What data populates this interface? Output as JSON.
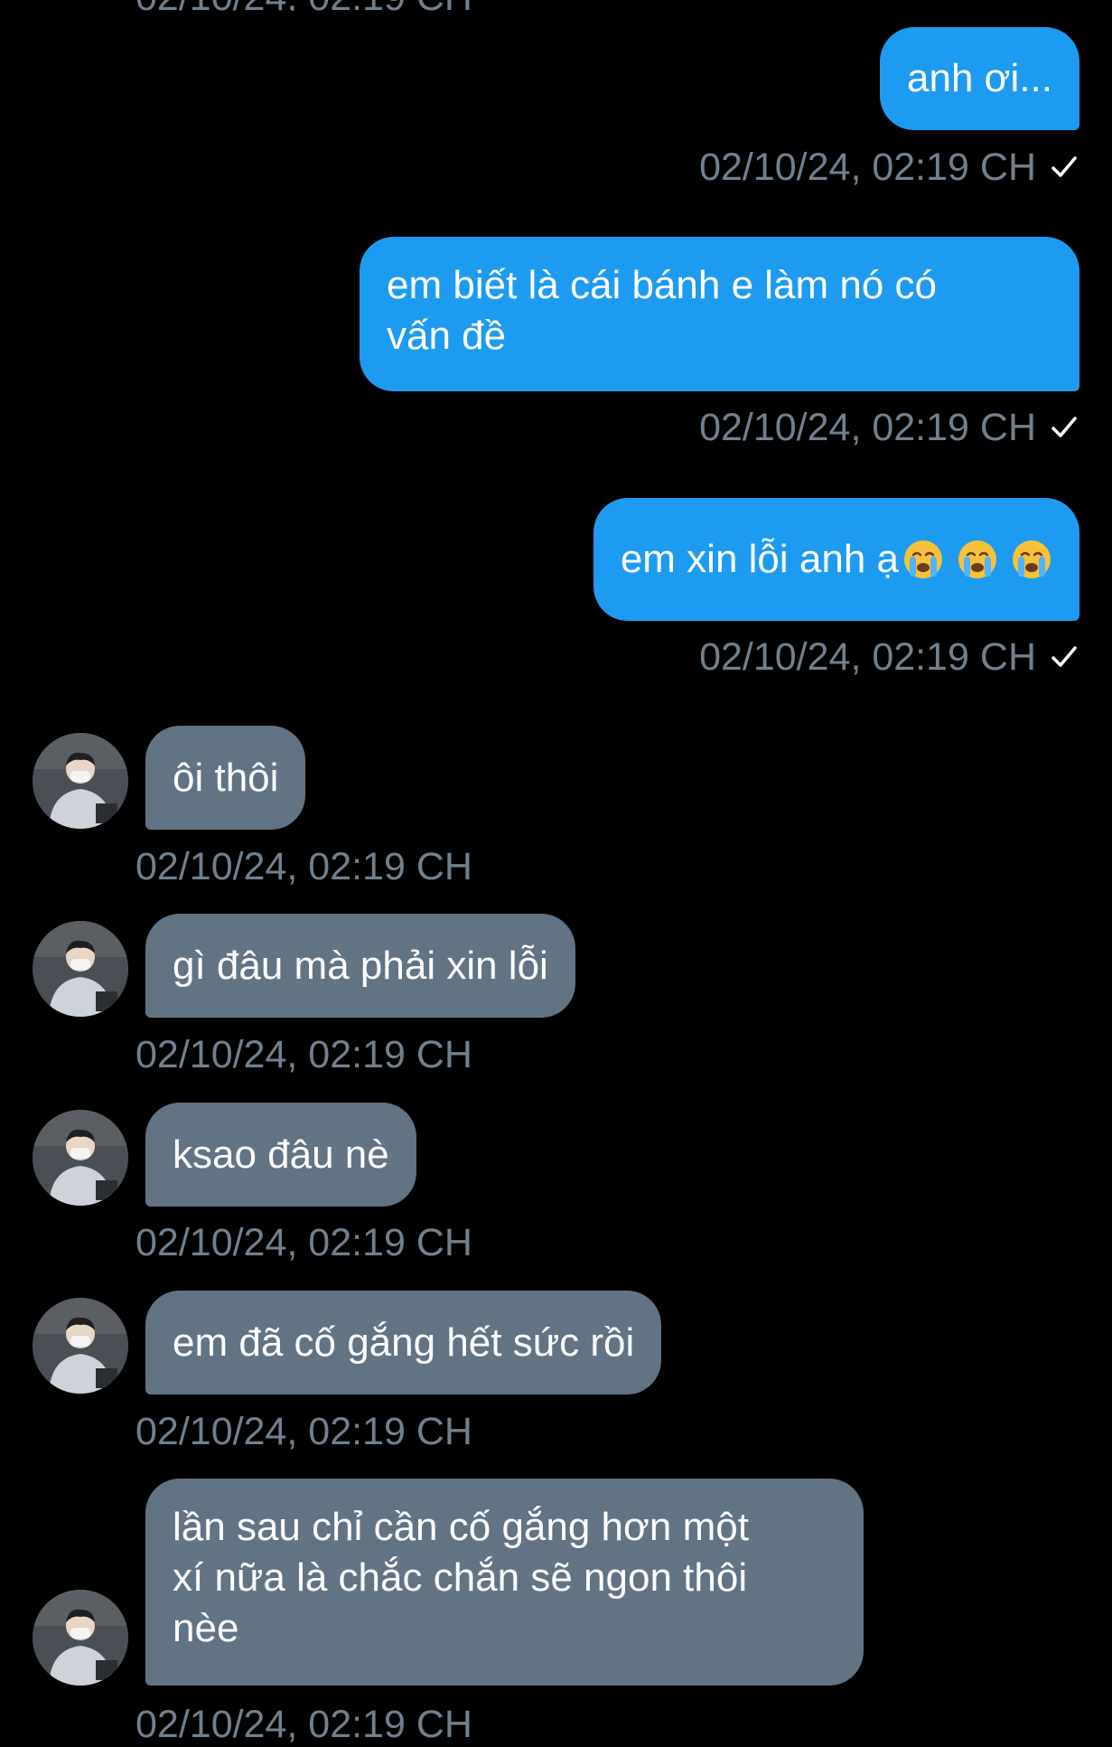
{
  "messages": [
    {
      "direction": "out",
      "text": "anh ơi...",
      "meta": "02/10/24, 02:19 CH"
    },
    {
      "direction": "out",
      "lines": [
        "em biết là cái bánh e làm nó có",
        "vấn đề"
      ],
      "meta": "02/10/24, 02:19 CH"
    },
    {
      "direction": "out",
      "text": "em xin lỗi anh ạ",
      "emoji": [
        "crying-face",
        "crying-face",
        "crying-face"
      ],
      "meta": "02/10/24, 02:19 CH"
    },
    {
      "direction": "in",
      "text": "ôi thôi",
      "meta": "02/10/24, 02:19 CH"
    },
    {
      "direction": "in",
      "text": "gì đâu mà phải xin lỗi",
      "meta": "02/10/24, 02:19 CH"
    },
    {
      "direction": "in",
      "text": "ksao đâu nè",
      "meta": "02/10/24, 02:19 CH"
    },
    {
      "direction": "in",
      "text": "em đã cố gắng hết sức rồi",
      "meta": "02/10/24, 02:19 CH"
    },
    {
      "direction": "in",
      "lines": [
        "lần sau chỉ cần cố gắng hơn một",
        "xí nữa là chắc chắn sẽ ngon thôi",
        "nèe"
      ],
      "meta": "02/10/24, 02:19 CH"
    }
  ],
  "top_clipped_meta": "02/10/24, 02:19 CH",
  "colors": {
    "outgoing": "#1d9bf0",
    "incoming": "#627384",
    "meta": "#71808e",
    "background": "#000000"
  }
}
